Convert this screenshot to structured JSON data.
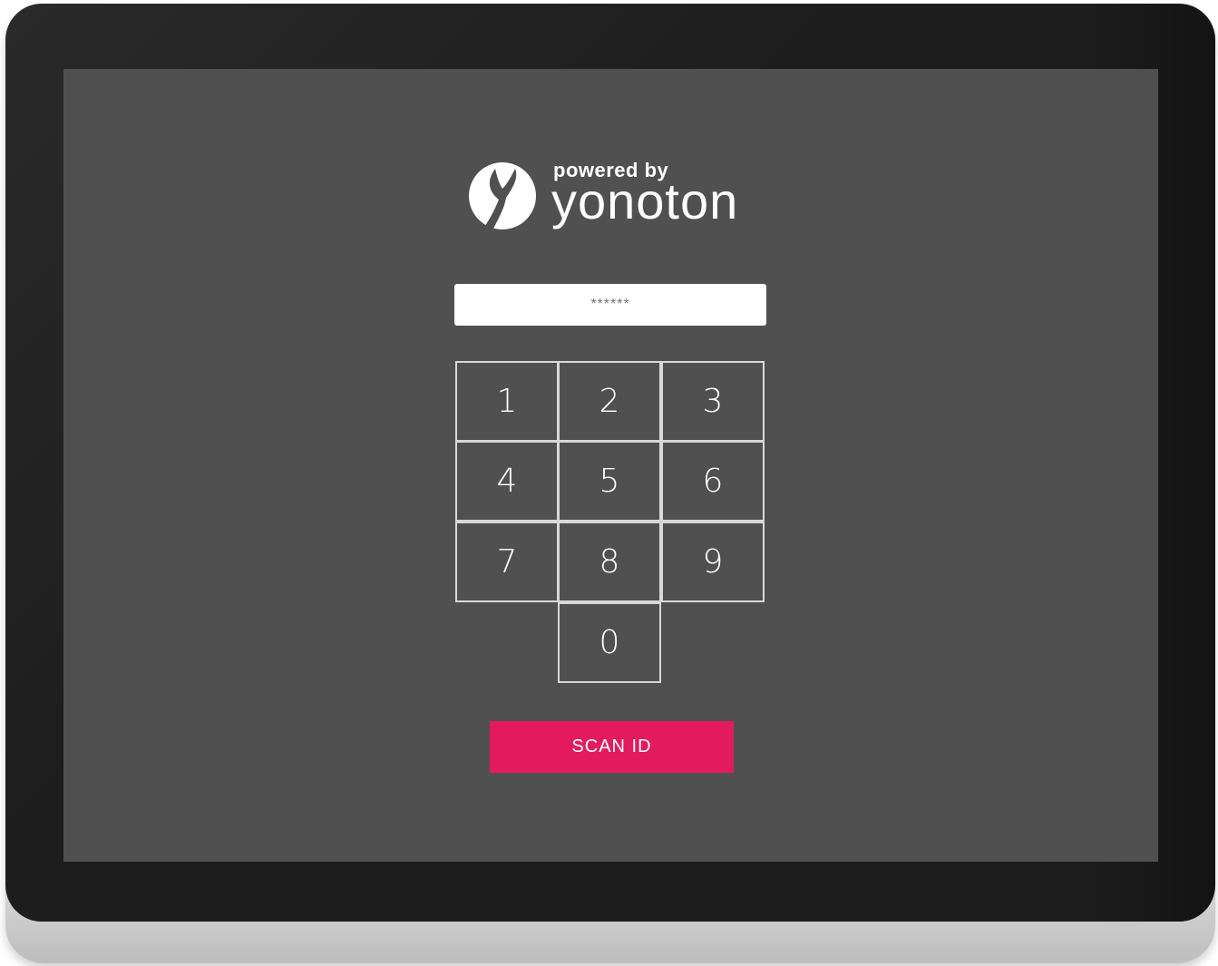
{
  "logo": {
    "powered_by": "powered by",
    "brand": "yonoton",
    "icon": "yonoton-leaf-icon"
  },
  "pin": {
    "placeholder": "******"
  },
  "keypad": {
    "keys": [
      "1",
      "2",
      "3",
      "4",
      "5",
      "6",
      "7",
      "8",
      "9",
      "0"
    ]
  },
  "scan_button": {
    "label": "SCAN ID"
  },
  "colors": {
    "screen_bg": "#505050",
    "bezel": "#1d1d1d",
    "accent": "#e31b5e",
    "key_border": "#d8d8d8"
  }
}
